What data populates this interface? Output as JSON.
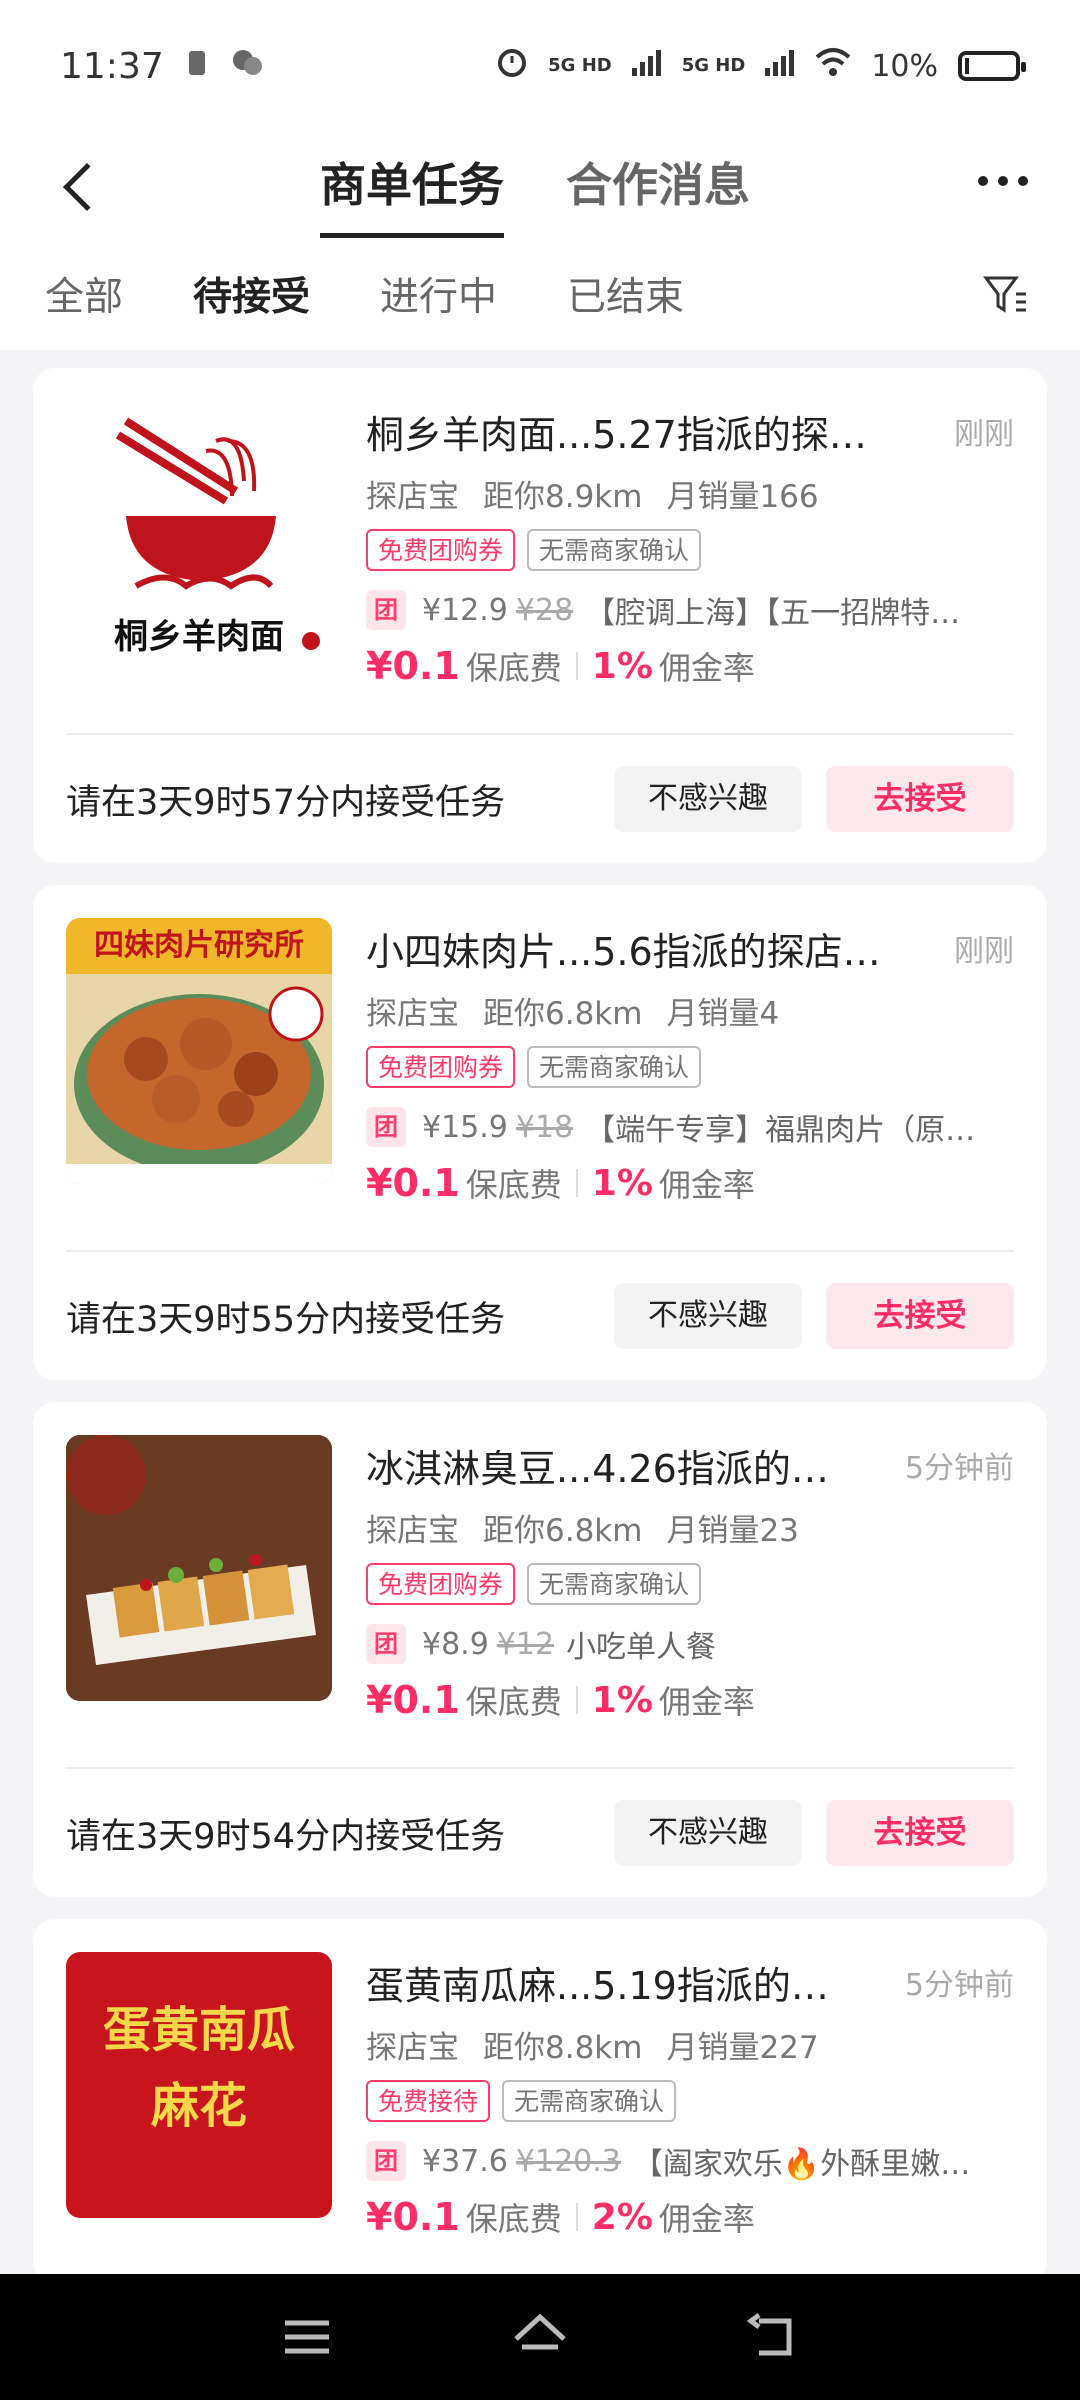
{
  "status_bar": {
    "time": "11:37",
    "signal1": "5G HD",
    "signal2": "5G HD",
    "battery": "10%"
  },
  "header": {
    "tabs": [
      "商单任务",
      "合作消息"
    ],
    "active_tab": 0
  },
  "filters": {
    "tabs": [
      "全部",
      "待接受",
      "进行中",
      "已结束"
    ],
    "active": 1
  },
  "cards": [
    {
      "title": "桐乡羊肉面...5.27指派的探…",
      "time": "刚刚",
      "source": "探店宝",
      "distance": "距你8.9km",
      "sales": "月销量166",
      "tag1": "免费团购券",
      "tag2": "无需商家确认",
      "tuan": "团",
      "price": "¥12.9",
      "old_price": "¥28",
      "desc": "【腔调上海】【五一招牌特…",
      "fee": "¥0.1",
      "fee_label": "保底费",
      "rate": "1%",
      "rate_label": "佣金率",
      "deadline": "请在3天9时57分内接受任务",
      "btn_no": "不感兴趣",
      "btn_go": "去接受",
      "thumb_text": "桐乡羊肉面"
    },
    {
      "title": "小四妹肉片...5.6指派的探店…",
      "time": "刚刚",
      "source": "探店宝",
      "distance": "距你6.8km",
      "sales": "月销量4",
      "tag1": "免费团购券",
      "tag2": "无需商家确认",
      "tuan": "团",
      "price": "¥15.9",
      "old_price": "¥18",
      "desc": "【端午专享】福鼎肉片（原…",
      "fee": "¥0.1",
      "fee_label": "保底费",
      "rate": "1%",
      "rate_label": "佣金率",
      "deadline": "请在3天9时55分内接受任务",
      "btn_no": "不感兴趣",
      "btn_go": "去接受",
      "thumb_text": "四妹肉片研究所"
    },
    {
      "title": "冰淇淋臭豆...4.26指派的…",
      "time": "5分钟前",
      "source": "探店宝",
      "distance": "距你6.8km",
      "sales": "月销量23",
      "tag1": "免费团购券",
      "tag2": "无需商家确认",
      "tuan": "团",
      "price": "¥8.9",
      "old_price": "¥12",
      "desc": "小吃单人餐",
      "fee": "¥0.1",
      "fee_label": "保底费",
      "rate": "1%",
      "rate_label": "佣金率",
      "deadline": "请在3天9时54分内接受任务",
      "btn_no": "不感兴趣",
      "btn_go": "去接受",
      "thumb_text": ""
    },
    {
      "title": "蛋黄南瓜麻...5.19指派的…",
      "time": "5分钟前",
      "source": "探店宝",
      "distance": "距你8.8km",
      "sales": "月销量227",
      "tag1": "免费接待",
      "tag2": "无需商家确认",
      "tuan": "团",
      "price": "¥37.6",
      "old_price": "¥120.3",
      "desc": "【阖家欢乐🔥外酥里嫩…",
      "fee": "¥0.1",
      "fee_label": "保底费",
      "rate": "2%",
      "rate_label": "佣金率",
      "deadline": "",
      "btn_no": "",
      "btn_go": "",
      "thumb_text": "蛋黄南瓜麻花"
    }
  ]
}
